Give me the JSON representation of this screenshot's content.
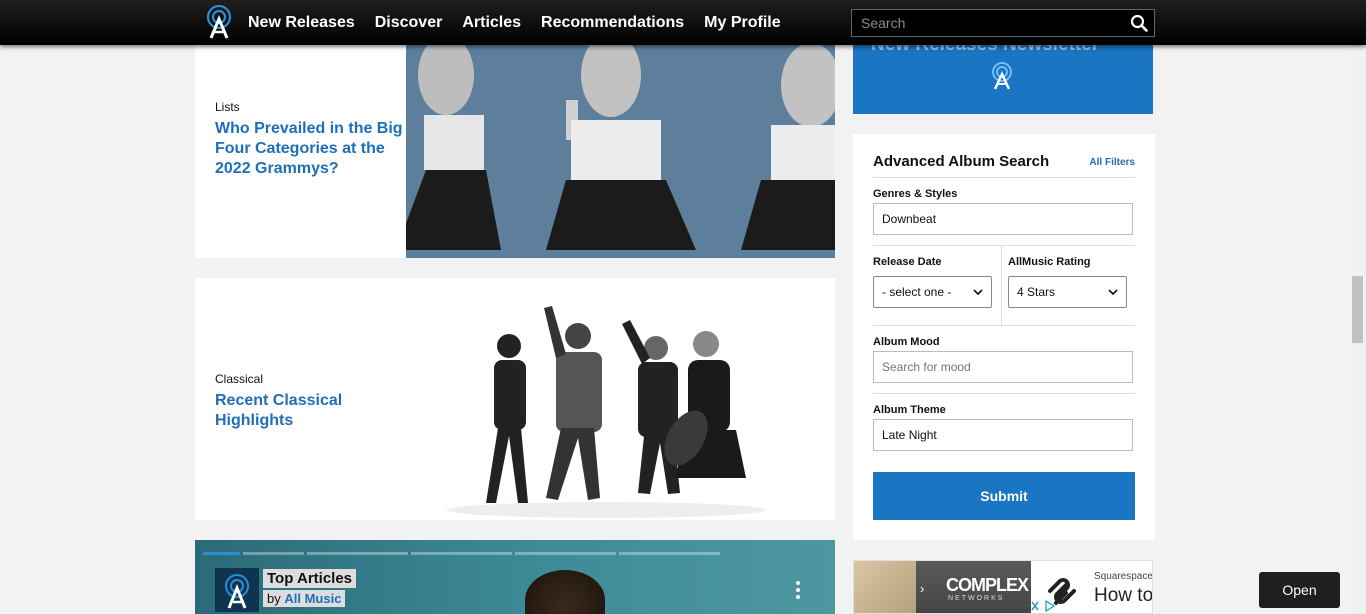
{
  "nav": {
    "links": [
      "New Releases",
      "Discover",
      "Articles",
      "Recommendations",
      "My Profile"
    ],
    "search_placeholder": "Search"
  },
  "articles": [
    {
      "category": "Lists",
      "title": "Who Prevailed in the Big Four Categories at the 2022 Grammys?"
    },
    {
      "category": "Classical",
      "title": "Recent Classical Highlights"
    }
  ],
  "carousel": {
    "heading": "Top Articles",
    "by_prefix": "by",
    "by_author": "All Music"
  },
  "newsletter": {
    "title_partial": "New Releases Newsletter"
  },
  "advanced_search": {
    "title": "Advanced Album Search",
    "all_filters": "All Filters",
    "genres_label": "Genres & Styles",
    "genres_value": "Downbeat",
    "release_label": "Release Date",
    "release_value": "- select one -",
    "rating_label": "AllMusic Rating",
    "rating_value": "4 Stars",
    "mood_label": "Album Mood",
    "mood_placeholder": "Search for mood",
    "theme_label": "Album Theme",
    "theme_value": "Late Night",
    "submit": "Submit"
  },
  "ad": {
    "complex_logo": "COMPLEX",
    "complex_sub": "NETWORKS",
    "brand": "Squarespace",
    "headline": "How to Sell Online",
    "button": "Open"
  },
  "colors": {
    "accent": "#1a75c2",
    "link": "#1e6fb8",
    "navbar": "#000000"
  }
}
